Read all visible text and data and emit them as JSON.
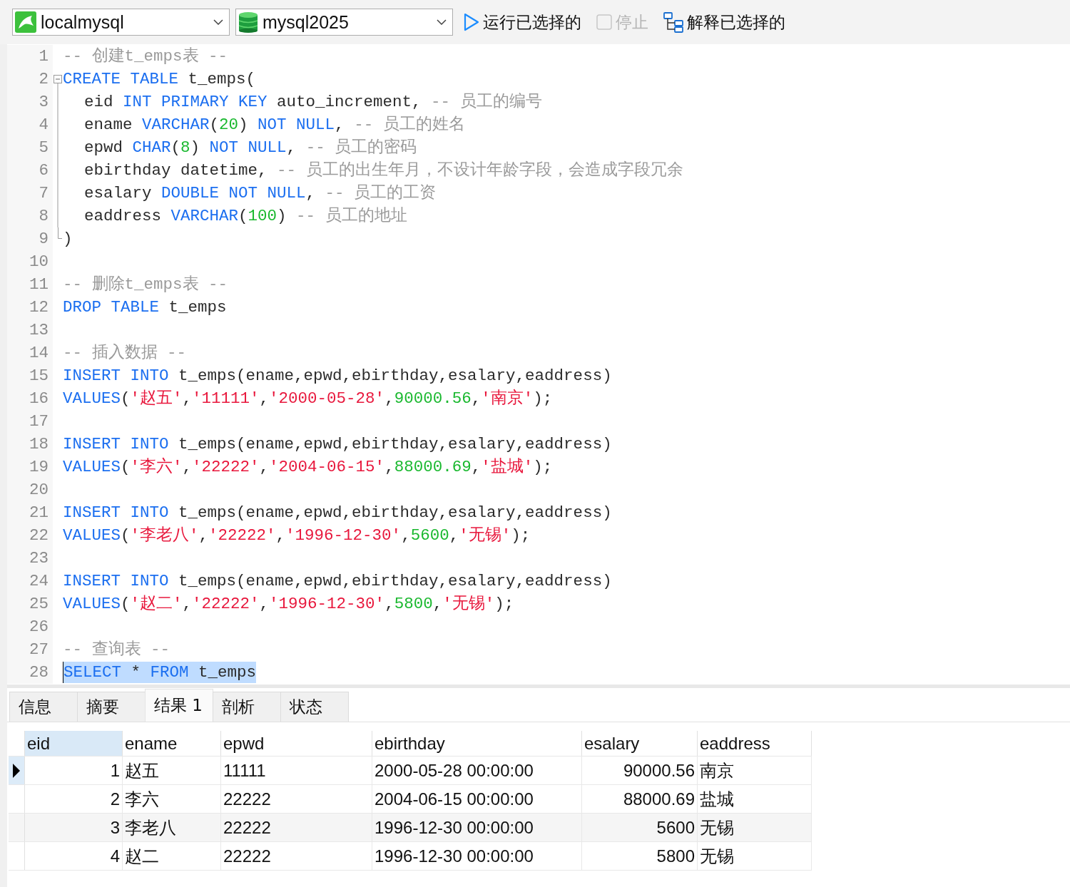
{
  "toolbar": {
    "connection": {
      "label": "localmysql"
    },
    "database": {
      "label": "mysql2025"
    },
    "run_button": {
      "label": "运行已选择的"
    },
    "stop_button": {
      "label": "停止",
      "disabled": true
    },
    "explain_button": {
      "label": "解释已选择的"
    }
  },
  "editor": {
    "lines": [
      {
        "number": "1",
        "tokens": [
          {
            "text": "-- 创建t_emps表 --",
            "kind": "comment"
          }
        ]
      },
      {
        "number": "2",
        "kind": "fold_start",
        "tokens": [
          {
            "text": "CREATE TABLE",
            "kind": "keyword"
          },
          {
            "text": " t_emps(",
            "kind": "plain"
          }
        ]
      },
      {
        "number": "3",
        "kind": "fold_body",
        "indent": true,
        "tokens": [
          {
            "text": "eid ",
            "kind": "plain"
          },
          {
            "text": "INT PRIMARY KEY",
            "kind": "keyword"
          },
          {
            "text": " auto_increment, ",
            "kind": "plain"
          },
          {
            "text": "-- 员工的编号",
            "kind": "comment"
          }
        ]
      },
      {
        "number": "4",
        "kind": "fold_body",
        "indent": true,
        "tokens": [
          {
            "text": "ename ",
            "kind": "plain"
          },
          {
            "text": "VARCHAR",
            "kind": "keyword"
          },
          {
            "text": "(",
            "kind": "plain"
          },
          {
            "text": "20",
            "kind": "number"
          },
          {
            "text": ") ",
            "kind": "plain"
          },
          {
            "text": "NOT NULL",
            "kind": "keyword"
          },
          {
            "text": ", ",
            "kind": "plain"
          },
          {
            "text": "-- 员工的姓名",
            "kind": "comment"
          }
        ]
      },
      {
        "number": "5",
        "kind": "fold_body",
        "indent": true,
        "tokens": [
          {
            "text": "epwd ",
            "kind": "plain"
          },
          {
            "text": "CHAR",
            "kind": "keyword"
          },
          {
            "text": "(",
            "kind": "plain"
          },
          {
            "text": "8",
            "kind": "number"
          },
          {
            "text": ") ",
            "kind": "plain"
          },
          {
            "text": "NOT NULL",
            "kind": "keyword"
          },
          {
            "text": ", ",
            "kind": "plain"
          },
          {
            "text": "-- 员工的密码",
            "kind": "comment"
          }
        ]
      },
      {
        "number": "6",
        "kind": "fold_body",
        "indent": true,
        "tokens": [
          {
            "text": "ebirthday datetime, ",
            "kind": "plain"
          },
          {
            "text": "-- 员工的出生年月，不设计年龄字段，会造成字段冗余",
            "kind": "comment"
          }
        ]
      },
      {
        "number": "7",
        "kind": "fold_body",
        "indent": true,
        "tokens": [
          {
            "text": "esalary ",
            "kind": "plain"
          },
          {
            "text": "DOUBLE NOT NULL",
            "kind": "keyword"
          },
          {
            "text": ", ",
            "kind": "plain"
          },
          {
            "text": "-- 员工的工资",
            "kind": "comment"
          }
        ]
      },
      {
        "number": "8",
        "kind": "fold_body",
        "indent": true,
        "tokens": [
          {
            "text": "eaddress ",
            "kind": "plain"
          },
          {
            "text": "VARCHAR",
            "kind": "keyword"
          },
          {
            "text": "(",
            "kind": "plain"
          },
          {
            "text": "100",
            "kind": "number"
          },
          {
            "text": ") ",
            "kind": "plain"
          },
          {
            "text": "-- 员工的地址",
            "kind": "comment"
          }
        ]
      },
      {
        "number": "9",
        "kind": "fold_end",
        "tokens": [
          {
            "text": ")",
            "kind": "plain"
          }
        ]
      },
      {
        "number": "10"
      },
      {
        "number": "11",
        "tokens": [
          {
            "text": "-- 删除t_emps表 --",
            "kind": "comment"
          }
        ]
      },
      {
        "number": "12",
        "tokens": [
          {
            "text": "DROP TABLE",
            "kind": "keyword"
          },
          {
            "text": " t_emps",
            "kind": "plain"
          }
        ]
      },
      {
        "number": "13"
      },
      {
        "number": "14",
        "tokens": [
          {
            "text": "-- 插入数据 --",
            "kind": "comment"
          }
        ]
      },
      {
        "number": "15",
        "tokens": [
          {
            "text": "INSERT INTO",
            "kind": "keyword"
          },
          {
            "text": " t_emps(ename,epwd,ebirthday,esalary,eaddress)",
            "kind": "plain"
          }
        ]
      },
      {
        "number": "16",
        "tokens": [
          {
            "text": "VALUES",
            "kind": "keyword"
          },
          {
            "text": "(",
            "kind": "plain"
          },
          {
            "text": "'赵五'",
            "kind": "string"
          },
          {
            "text": ",",
            "kind": "plain"
          },
          {
            "text": "'11111'",
            "kind": "string"
          },
          {
            "text": ",",
            "kind": "plain"
          },
          {
            "text": "'2000-05-28'",
            "kind": "string"
          },
          {
            "text": ",",
            "kind": "plain"
          },
          {
            "text": "90000.56",
            "kind": "number"
          },
          {
            "text": ",",
            "kind": "plain"
          },
          {
            "text": "'南京'",
            "kind": "string"
          },
          {
            "text": ");",
            "kind": "plain"
          }
        ]
      },
      {
        "number": "17"
      },
      {
        "number": "18",
        "tokens": [
          {
            "text": "INSERT INTO",
            "kind": "keyword"
          },
          {
            "text": " t_emps(ename,epwd,ebirthday,esalary,eaddress)",
            "kind": "plain"
          }
        ]
      },
      {
        "number": "19",
        "tokens": [
          {
            "text": "VALUES",
            "kind": "keyword"
          },
          {
            "text": "(",
            "kind": "plain"
          },
          {
            "text": "'李六'",
            "kind": "string"
          },
          {
            "text": ",",
            "kind": "plain"
          },
          {
            "text": "'22222'",
            "kind": "string"
          },
          {
            "text": ",",
            "kind": "plain"
          },
          {
            "text": "'2004-06-15'",
            "kind": "string"
          },
          {
            "text": ",",
            "kind": "plain"
          },
          {
            "text": "88000.69",
            "kind": "number"
          },
          {
            "text": ",",
            "kind": "plain"
          },
          {
            "text": "'盐城'",
            "kind": "string"
          },
          {
            "text": ");",
            "kind": "plain"
          }
        ]
      },
      {
        "number": "20"
      },
      {
        "number": "21",
        "tokens": [
          {
            "text": "INSERT INTO",
            "kind": "keyword"
          },
          {
            "text": " t_emps(ename,epwd,ebirthday,esalary,eaddress)",
            "kind": "plain"
          }
        ]
      },
      {
        "number": "22",
        "tokens": [
          {
            "text": "VALUES",
            "kind": "keyword"
          },
          {
            "text": "(",
            "kind": "plain"
          },
          {
            "text": "'李老八'",
            "kind": "string"
          },
          {
            "text": ",",
            "kind": "plain"
          },
          {
            "text": "'22222'",
            "kind": "string"
          },
          {
            "text": ",",
            "kind": "plain"
          },
          {
            "text": "'1996-12-30'",
            "kind": "string"
          },
          {
            "text": ",",
            "kind": "plain"
          },
          {
            "text": "5600",
            "kind": "number"
          },
          {
            "text": ",",
            "kind": "plain"
          },
          {
            "text": "'无锡'",
            "kind": "string"
          },
          {
            "text": ");",
            "kind": "plain"
          }
        ]
      },
      {
        "number": "23"
      },
      {
        "number": "24",
        "tokens": [
          {
            "text": "INSERT INTO",
            "kind": "keyword"
          },
          {
            "text": " t_emps(ename,epwd,ebirthday,esalary,eaddress)",
            "kind": "plain"
          }
        ]
      },
      {
        "number": "25",
        "tokens": [
          {
            "text": "VALUES",
            "kind": "keyword"
          },
          {
            "text": "(",
            "kind": "plain"
          },
          {
            "text": "'赵二'",
            "kind": "string"
          },
          {
            "text": ",",
            "kind": "plain"
          },
          {
            "text": "'22222'",
            "kind": "string"
          },
          {
            "text": ",",
            "kind": "plain"
          },
          {
            "text": "'1996-12-30'",
            "kind": "string"
          },
          {
            "text": ",",
            "kind": "plain"
          },
          {
            "text": "5800",
            "kind": "number"
          },
          {
            "text": ",",
            "kind": "plain"
          },
          {
            "text": "'无锡'",
            "kind": "string"
          },
          {
            "text": ");",
            "kind": "plain"
          }
        ]
      },
      {
        "number": "26"
      },
      {
        "number": "27",
        "tokens": [
          {
            "text": "-- 查询表 --",
            "kind": "comment"
          }
        ]
      },
      {
        "number": "28",
        "selected": true,
        "tokens": [
          {
            "text": "SELECT",
            "kind": "keyword"
          },
          {
            "text": " * ",
            "kind": "plain"
          },
          {
            "text": "FROM",
            "kind": "keyword"
          },
          {
            "text": " t_emps",
            "kind": "plain"
          }
        ]
      }
    ]
  },
  "result_tabs": [
    {
      "label": "信息",
      "selected": false
    },
    {
      "label": "摘要",
      "selected": false
    },
    {
      "label": "结果 1",
      "selected": true
    },
    {
      "label": "剖析",
      "selected": false
    },
    {
      "label": "状态",
      "selected": false
    }
  ],
  "table": {
    "columns": [
      {
        "label": "eid",
        "selected": true,
        "kind": "numeric"
      },
      {
        "label": "ename",
        "selected": false,
        "kind": "text"
      },
      {
        "label": "epwd",
        "selected": false,
        "kind": "text"
      },
      {
        "label": "ebirthday",
        "selected": false,
        "kind": "text"
      },
      {
        "label": "esalary",
        "selected": false,
        "kind": "numeric"
      },
      {
        "label": "eaddress",
        "selected": false,
        "kind": "text"
      }
    ],
    "rows": [
      {
        "current": true,
        "cells": [
          "1",
          "赵五",
          "11111",
          "2000-05-28 00:00:00",
          "90000.56",
          "南京"
        ]
      },
      {
        "current": false,
        "cells": [
          "2",
          "李六",
          "22222",
          "2004-06-15 00:00:00",
          "88000.69",
          "盐城"
        ]
      },
      {
        "current": false,
        "cells": [
          "3",
          "李老八",
          "22222",
          "1996-12-30 00:00:00",
          "5600",
          "无锡"
        ]
      },
      {
        "current": false,
        "cells": [
          "4",
          "赵二",
          "22222",
          "1996-12-30 00:00:00",
          "5800",
          "无锡"
        ]
      }
    ]
  }
}
